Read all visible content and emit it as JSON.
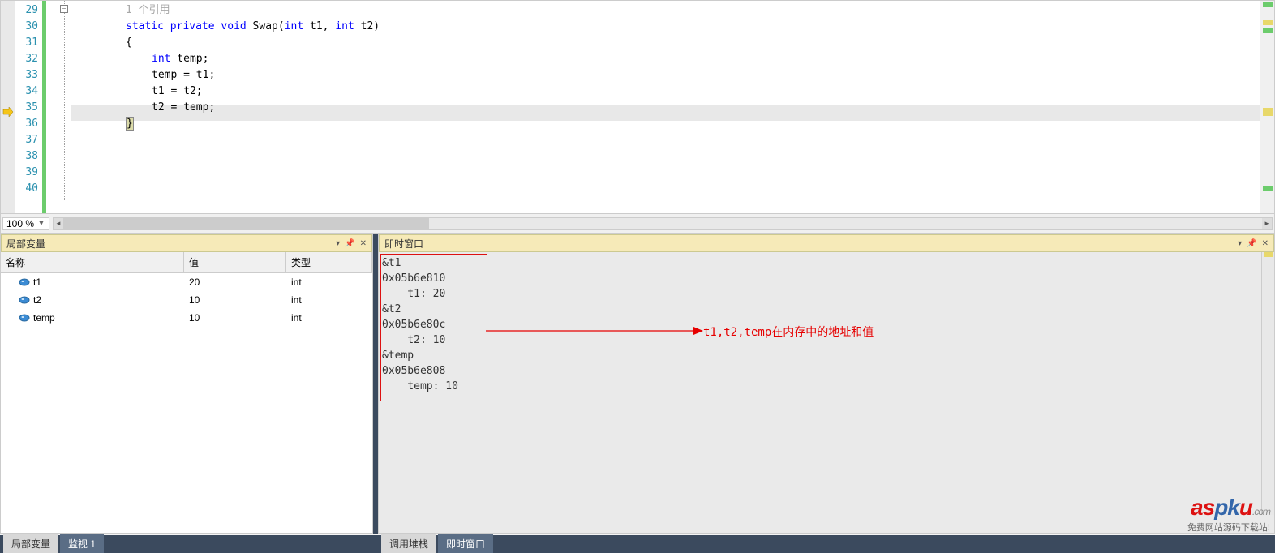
{
  "editor": {
    "zoom": "100 %",
    "codelens": "1 个引用",
    "lines": [
      29,
      30,
      31,
      32,
      33,
      34,
      35,
      36,
      37,
      38,
      39,
      40
    ],
    "current_line": 35,
    "code_tokens": [
      {
        "indent": 8,
        "segs": [
          {
            "t": "static",
            "c": "kw"
          },
          {
            "t": " "
          },
          {
            "t": "private",
            "c": "kw"
          },
          {
            "t": " "
          },
          {
            "t": "void",
            "c": "kw"
          },
          {
            "t": " Swap("
          },
          {
            "t": "int",
            "c": "kw"
          },
          {
            "t": " t1, "
          },
          {
            "t": "int",
            "c": "kw"
          },
          {
            "t": " t2)"
          }
        ]
      },
      {
        "indent": 8,
        "segs": [
          {
            "t": "{"
          }
        ]
      },
      {
        "indent": 12,
        "segs": [
          {
            "t": "int",
            "c": "kw"
          },
          {
            "t": " temp;"
          }
        ]
      },
      {
        "indent": 12,
        "segs": [
          {
            "t": "temp = t1;"
          }
        ]
      },
      {
        "indent": 12,
        "segs": [
          {
            "t": "t1 = t2;"
          }
        ]
      },
      {
        "indent": 12,
        "segs": [
          {
            "t": "t2 = temp;"
          }
        ]
      },
      {
        "indent": 8,
        "segs": [
          {
            "t": "}",
            "c": "brace-hl"
          }
        ]
      },
      {
        "indent": 0,
        "segs": []
      },
      {
        "indent": 0,
        "segs": []
      },
      {
        "indent": 0,
        "segs": []
      },
      {
        "indent": 0,
        "segs": []
      },
      {
        "indent": 0,
        "segs": []
      }
    ]
  },
  "locals": {
    "title": "局部变量",
    "columns": {
      "name": "名称",
      "value": "值",
      "type": "类型"
    },
    "rows": [
      {
        "name": "t1",
        "value": "20",
        "type": "int"
      },
      {
        "name": "t2",
        "value": "10",
        "type": "int"
      },
      {
        "name": "temp",
        "value": "10",
        "type": "int"
      }
    ],
    "tabs": [
      {
        "label": "局部变量",
        "active": false
      },
      {
        "label": "监视 1",
        "active": true
      }
    ]
  },
  "immediate": {
    "title": "即时窗口",
    "content": "&t1\n0x05b6e810\n    t1: 20\n&t2\n0x05b6e80c\n    t2: 10\n&temp\n0x05b6e808\n    temp: 10",
    "annotation": "t1,t2,temp在内存中的地址和值",
    "tabs": [
      {
        "label": "调用堆栈",
        "active": false
      },
      {
        "label": "即时窗口",
        "active": true
      }
    ]
  },
  "watermark": {
    "logo": "aspku",
    "suffix": ".com",
    "tagline": "免费网站源码下载站!"
  }
}
